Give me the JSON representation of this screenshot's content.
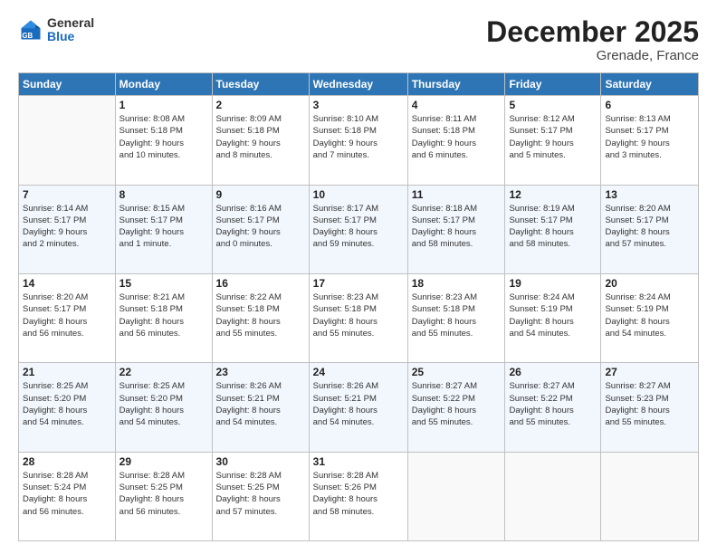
{
  "logo": {
    "general": "General",
    "blue": "Blue"
  },
  "title": "December 2025",
  "subtitle": "Grenade, France",
  "headers": [
    "Sunday",
    "Monday",
    "Tuesday",
    "Wednesday",
    "Thursday",
    "Friday",
    "Saturday"
  ],
  "weeks": [
    [
      {
        "day": "",
        "detail": ""
      },
      {
        "day": "1",
        "detail": "Sunrise: 8:08 AM\nSunset: 5:18 PM\nDaylight: 9 hours\nand 10 minutes."
      },
      {
        "day": "2",
        "detail": "Sunrise: 8:09 AM\nSunset: 5:18 PM\nDaylight: 9 hours\nand 8 minutes."
      },
      {
        "day": "3",
        "detail": "Sunrise: 8:10 AM\nSunset: 5:18 PM\nDaylight: 9 hours\nand 7 minutes."
      },
      {
        "day": "4",
        "detail": "Sunrise: 8:11 AM\nSunset: 5:18 PM\nDaylight: 9 hours\nand 6 minutes."
      },
      {
        "day": "5",
        "detail": "Sunrise: 8:12 AM\nSunset: 5:17 PM\nDaylight: 9 hours\nand 5 minutes."
      },
      {
        "day": "6",
        "detail": "Sunrise: 8:13 AM\nSunset: 5:17 PM\nDaylight: 9 hours\nand 3 minutes."
      }
    ],
    [
      {
        "day": "7",
        "detail": "Sunrise: 8:14 AM\nSunset: 5:17 PM\nDaylight: 9 hours\nand 2 minutes."
      },
      {
        "day": "8",
        "detail": "Sunrise: 8:15 AM\nSunset: 5:17 PM\nDaylight: 9 hours\nand 1 minute."
      },
      {
        "day": "9",
        "detail": "Sunrise: 8:16 AM\nSunset: 5:17 PM\nDaylight: 9 hours\nand 0 minutes."
      },
      {
        "day": "10",
        "detail": "Sunrise: 8:17 AM\nSunset: 5:17 PM\nDaylight: 8 hours\nand 59 minutes."
      },
      {
        "day": "11",
        "detail": "Sunrise: 8:18 AM\nSunset: 5:17 PM\nDaylight: 8 hours\nand 58 minutes."
      },
      {
        "day": "12",
        "detail": "Sunrise: 8:19 AM\nSunset: 5:17 PM\nDaylight: 8 hours\nand 58 minutes."
      },
      {
        "day": "13",
        "detail": "Sunrise: 8:20 AM\nSunset: 5:17 PM\nDaylight: 8 hours\nand 57 minutes."
      }
    ],
    [
      {
        "day": "14",
        "detail": "Sunrise: 8:20 AM\nSunset: 5:17 PM\nDaylight: 8 hours\nand 56 minutes."
      },
      {
        "day": "15",
        "detail": "Sunrise: 8:21 AM\nSunset: 5:18 PM\nDaylight: 8 hours\nand 56 minutes."
      },
      {
        "day": "16",
        "detail": "Sunrise: 8:22 AM\nSunset: 5:18 PM\nDaylight: 8 hours\nand 55 minutes."
      },
      {
        "day": "17",
        "detail": "Sunrise: 8:23 AM\nSunset: 5:18 PM\nDaylight: 8 hours\nand 55 minutes."
      },
      {
        "day": "18",
        "detail": "Sunrise: 8:23 AM\nSunset: 5:18 PM\nDaylight: 8 hours\nand 55 minutes."
      },
      {
        "day": "19",
        "detail": "Sunrise: 8:24 AM\nSunset: 5:19 PM\nDaylight: 8 hours\nand 54 minutes."
      },
      {
        "day": "20",
        "detail": "Sunrise: 8:24 AM\nSunset: 5:19 PM\nDaylight: 8 hours\nand 54 minutes."
      }
    ],
    [
      {
        "day": "21",
        "detail": "Sunrise: 8:25 AM\nSunset: 5:20 PM\nDaylight: 8 hours\nand 54 minutes."
      },
      {
        "day": "22",
        "detail": "Sunrise: 8:25 AM\nSunset: 5:20 PM\nDaylight: 8 hours\nand 54 minutes."
      },
      {
        "day": "23",
        "detail": "Sunrise: 8:26 AM\nSunset: 5:21 PM\nDaylight: 8 hours\nand 54 minutes."
      },
      {
        "day": "24",
        "detail": "Sunrise: 8:26 AM\nSunset: 5:21 PM\nDaylight: 8 hours\nand 54 minutes."
      },
      {
        "day": "25",
        "detail": "Sunrise: 8:27 AM\nSunset: 5:22 PM\nDaylight: 8 hours\nand 55 minutes."
      },
      {
        "day": "26",
        "detail": "Sunrise: 8:27 AM\nSunset: 5:22 PM\nDaylight: 8 hours\nand 55 minutes."
      },
      {
        "day": "27",
        "detail": "Sunrise: 8:27 AM\nSunset: 5:23 PM\nDaylight: 8 hours\nand 55 minutes."
      }
    ],
    [
      {
        "day": "28",
        "detail": "Sunrise: 8:28 AM\nSunset: 5:24 PM\nDaylight: 8 hours\nand 56 minutes."
      },
      {
        "day": "29",
        "detail": "Sunrise: 8:28 AM\nSunset: 5:25 PM\nDaylight: 8 hours\nand 56 minutes."
      },
      {
        "day": "30",
        "detail": "Sunrise: 8:28 AM\nSunset: 5:25 PM\nDaylight: 8 hours\nand 57 minutes."
      },
      {
        "day": "31",
        "detail": "Sunrise: 8:28 AM\nSunset: 5:26 PM\nDaylight: 8 hours\nand 58 minutes."
      },
      {
        "day": "",
        "detail": ""
      },
      {
        "day": "",
        "detail": ""
      },
      {
        "day": "",
        "detail": ""
      }
    ]
  ]
}
